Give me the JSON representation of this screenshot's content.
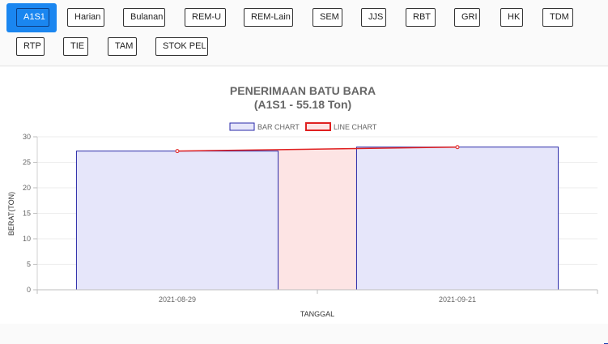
{
  "tabs": [
    {
      "label": "A1S1",
      "active": true
    },
    {
      "label": "Harian",
      "active": false
    },
    {
      "label": "Bulanan",
      "active": false
    },
    {
      "label": "REM-U",
      "active": false
    },
    {
      "label": "REM-Lain",
      "active": false
    },
    {
      "label": "SEM",
      "active": false
    },
    {
      "label": "JJS",
      "active": false
    },
    {
      "label": "RBT",
      "active": false
    },
    {
      "label": "GRI",
      "active": false
    },
    {
      "label": "HK",
      "active": false
    },
    {
      "label": "TDM",
      "active": false
    },
    {
      "label": "RTP",
      "active": false
    },
    {
      "label": "TIE",
      "active": false
    },
    {
      "label": "TAM",
      "active": false
    },
    {
      "label": "STOK PEL",
      "active": false
    }
  ],
  "chart_data": {
    "type": "bar",
    "title": "PENERIMAAN BATU BARA",
    "subtitle": "(A1S1 - 55.18 Ton)",
    "xlabel": "TANGGAL",
    "ylabel": "BERAT(TON)",
    "categories": [
      "2021-08-29",
      "2021-09-21"
    ],
    "ylim": [
      0,
      30
    ],
    "yticks": [
      0,
      5,
      10,
      15,
      20,
      25,
      30
    ],
    "grid": true,
    "legend_position": "top-center",
    "series": [
      {
        "name": "BAR CHART",
        "type": "bar",
        "values": [
          27.2,
          27.98
        ],
        "color": "#2a2aa8",
        "fill": "#e6e6fa"
      },
      {
        "name": "LINE CHART",
        "type": "area",
        "values": [
          27.2,
          27.98
        ],
        "color": "#e02020",
        "fill": "#fde4e4"
      }
    ]
  }
}
